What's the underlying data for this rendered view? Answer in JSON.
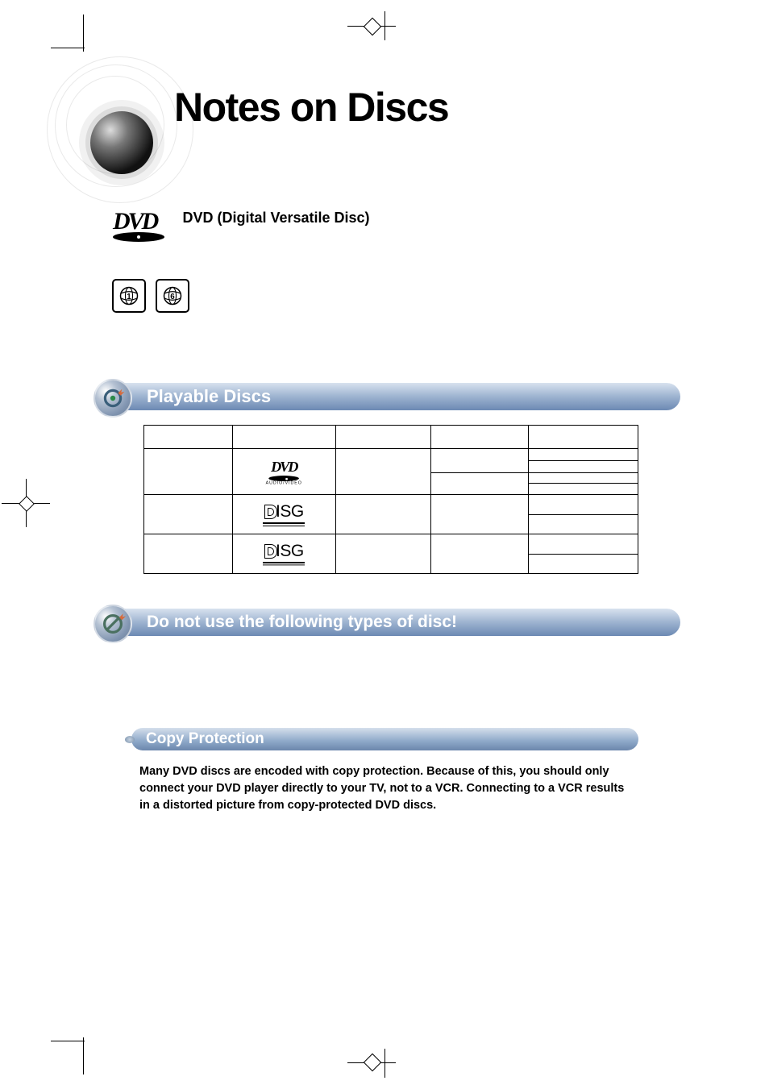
{
  "page_title": "Notes on Discs",
  "dvd_section_label": "DVD (Digital Versatile Disc)",
  "sections": {
    "playable": "Playable Discs",
    "do_not_use": "Do not use the following types of disc!",
    "copy_protection": "Copy Protection"
  },
  "copy_protection_text": "Many DVD discs are encoded with copy protection. Because of this, you should only connect your DVD player directly to your TV, not to a VCR. Connecting to a VCR results in a distorted picture from copy-protected DVD discs.",
  "region_codes": [
    "1",
    "6"
  ],
  "chart_data": {
    "type": "table",
    "title": "Playable Discs",
    "columns": [
      "",
      "",
      "",
      "",
      ""
    ],
    "rows": [
      {
        "disc_type": "",
        "mark": "DVD AUDIO/VIDEO",
        "col3": "",
        "col4": "",
        "col5_split": [
          "",
          ""
        ]
      },
      {
        "disc_type": "",
        "mark": "disc (compact disc logo, double-line)",
        "col3": "",
        "col4": "",
        "col5_split": [
          "",
          ""
        ]
      },
      {
        "disc_type": "",
        "mark": "disc (compact disc logo, shadow)",
        "col3": "",
        "col4": "",
        "col5_split": [
          "",
          ""
        ]
      }
    ]
  },
  "logo_text": {
    "dvd_main": "DVD",
    "dvd_sub": "AUDIO/VIDEO",
    "disc_outline": "ISG"
  }
}
